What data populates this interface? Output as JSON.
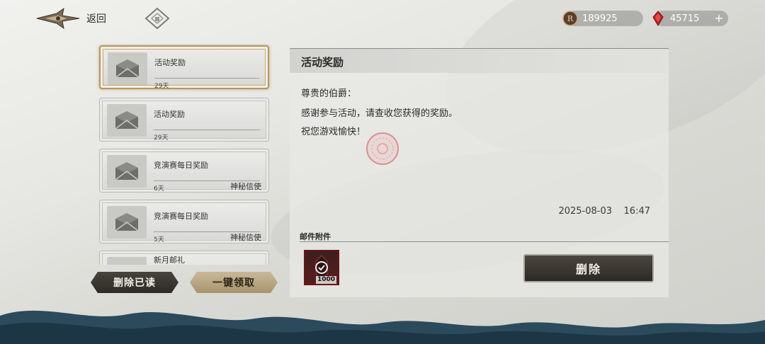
{
  "topbar": {
    "back_label": "返回",
    "gold_amount": "189925",
    "gem_amount": "45715",
    "plus_label": "+"
  },
  "mail_list": [
    {
      "title": "活动奖励",
      "days": "29天",
      "sender": "",
      "selected": true
    },
    {
      "title": "活动奖励",
      "days": "29天",
      "sender": "",
      "selected": false
    },
    {
      "title": "竞演赛每日奖励",
      "days": "6天",
      "sender": "神秘信使",
      "selected": false
    },
    {
      "title": "竞演赛每日奖励",
      "days": "5天",
      "sender": "神秘信使",
      "selected": false
    },
    {
      "title": "新月邮礼",
      "days": "",
      "sender": "",
      "selected": false
    }
  ],
  "left_buttons": {
    "delete_read": "删除已读",
    "claim_all": "一键领取"
  },
  "detail": {
    "title": "活动奖励",
    "greeting": "尊贵的伯爵：",
    "body": "感谢参与活动，请查收您获得的奖励。",
    "closing": "祝您游戏愉快！",
    "timestamp": "2025-08-03    16:47",
    "attachments_label": "邮件附件",
    "attachment_qty": "1000",
    "delete_button": "删除"
  },
  "colors": {
    "gold_border": "#b7965a",
    "attachment_bg": "#5a1c1c",
    "dark_button": "#2e2b27",
    "light_button": "#a8946e",
    "wave": "#2b4a5c"
  },
  "icons": {
    "back": "ornate-wing-emblem-icon",
    "home": "diamond-home-icon",
    "gold": "coin-icon",
    "gem": "red-gem-icon",
    "mail": "envelope-icon",
    "attachment": "check-badge-icon",
    "seal": "round-seal-icon"
  }
}
